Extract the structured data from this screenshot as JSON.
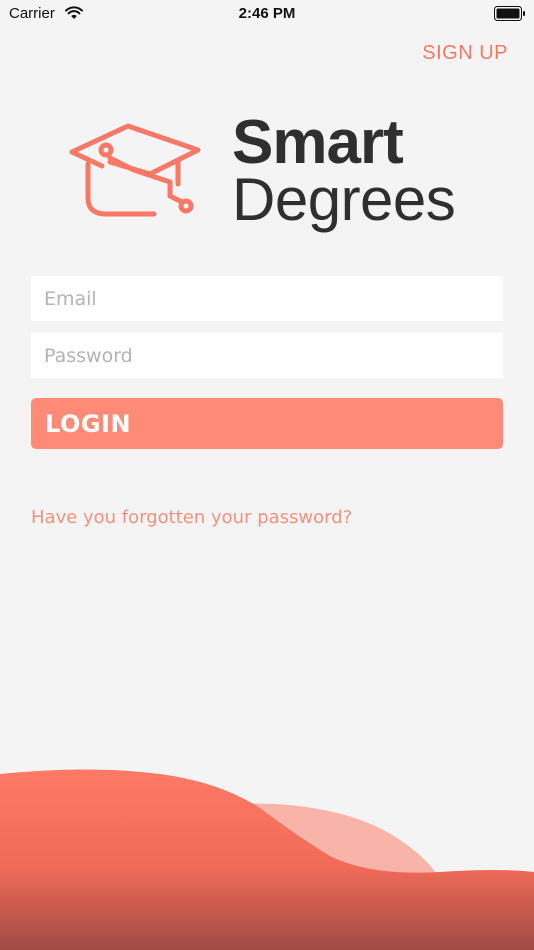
{
  "status_bar": {
    "carrier": "Carrier",
    "time": "2:46 PM",
    "wifi_icon": "wifi-icon",
    "battery_icon": "battery-icon"
  },
  "header": {
    "signup_label": "SIGN UP"
  },
  "logo": {
    "line1": "Smart",
    "line2": "Degrees",
    "icon": "graduation-cap-icon"
  },
  "form": {
    "email_placeholder": "Email",
    "email_value": "",
    "password_placeholder": "Password",
    "password_value": "",
    "login_label": "LOGIN",
    "forgot_label": "Have you forgotten your password?"
  },
  "colors": {
    "accent": "#f77866",
    "button": "#ff8a76",
    "background": "#f4f4f4",
    "text_dark": "#2f2f2f"
  }
}
